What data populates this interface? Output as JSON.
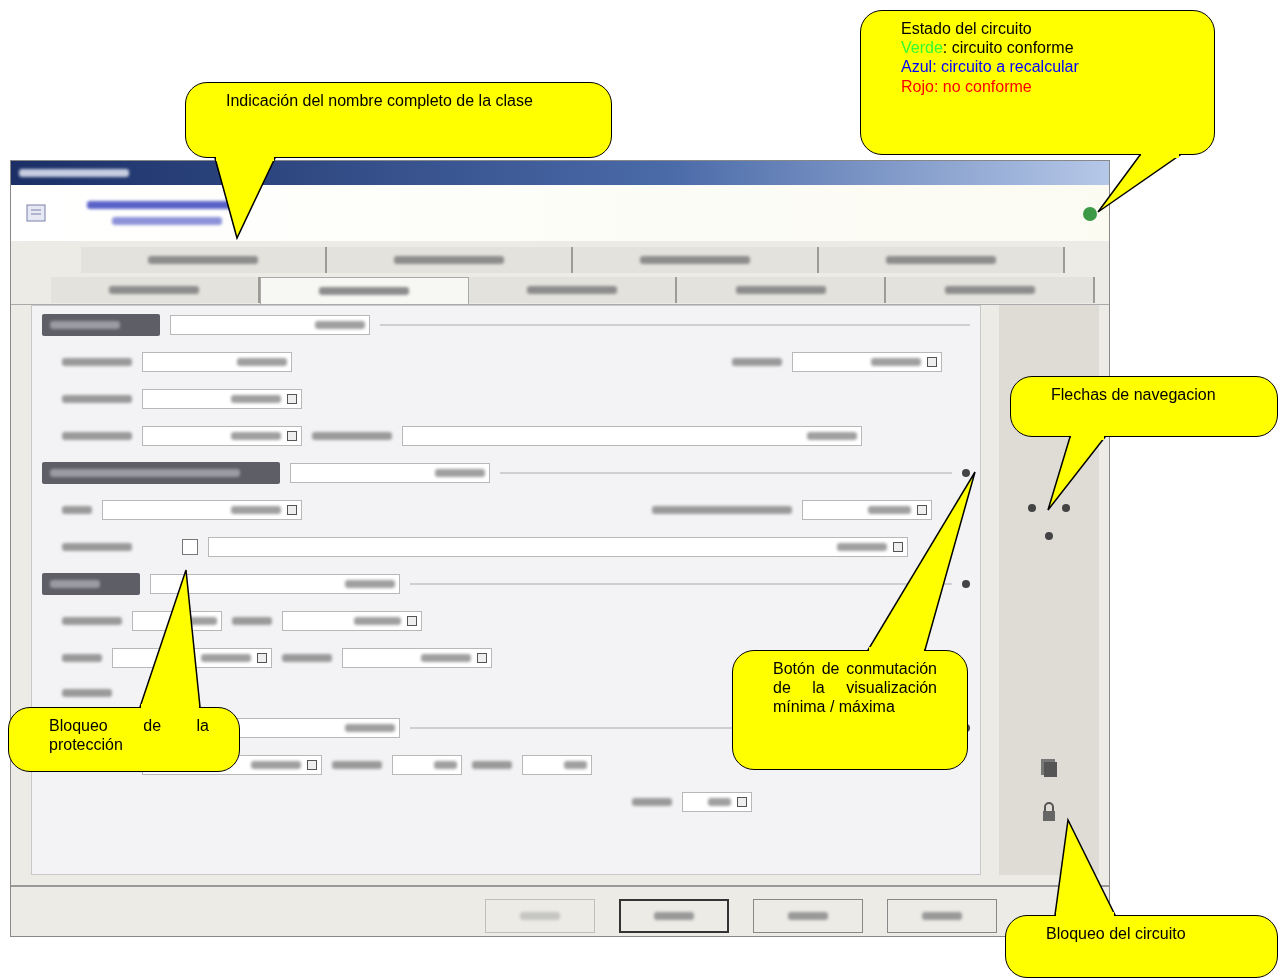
{
  "dialog": {
    "status": {
      "color": "#3c9a46"
    },
    "tabs": [
      [
        {
          "selected": false
        },
        {
          "selected": false
        },
        {
          "selected": false
        },
        {
          "selected": false
        }
      ],
      [
        {
          "selected": false
        },
        {
          "selected": true
        },
        {
          "selected": false
        },
        {
          "selected": false
        },
        {
          "selected": false
        }
      ]
    ],
    "protection_lock": {
      "checked": false
    },
    "buttons": [
      {
        "disabled": true
      },
      {
        "disabled": false
      },
      {
        "disabled": false
      },
      {
        "disabled": false
      }
    ]
  },
  "callouts": [
    {
      "kind": "class-name",
      "text": "Indicación del nombre completo de la clase"
    },
    {
      "kind": "status",
      "title": "Estado del circuito",
      "legend": [
        {
          "kind": "partial",
          "label": "Verde",
          "color": "#33ff33",
          "text": ": circuito conforme"
        },
        {
          "kind": "whole",
          "label": "Azul",
          "color": "#0000ff",
          "text": ": circuito a recalcular"
        },
        {
          "kind": "whole",
          "label": "Rojo",
          "color": "#ff0000",
          "text": ": no conforme"
        }
      ]
    },
    {
      "kind": "navigation",
      "text": "Flechas de navegacion"
    },
    {
      "kind": "view-toggle",
      "text": "Botón de conmutación de la visualización mínima / máxima"
    },
    {
      "kind": "protection-lock",
      "text": "Bloqueo de la protección"
    },
    {
      "kind": "circuit-lock",
      "text": "Bloqueo del circuito"
    }
  ]
}
